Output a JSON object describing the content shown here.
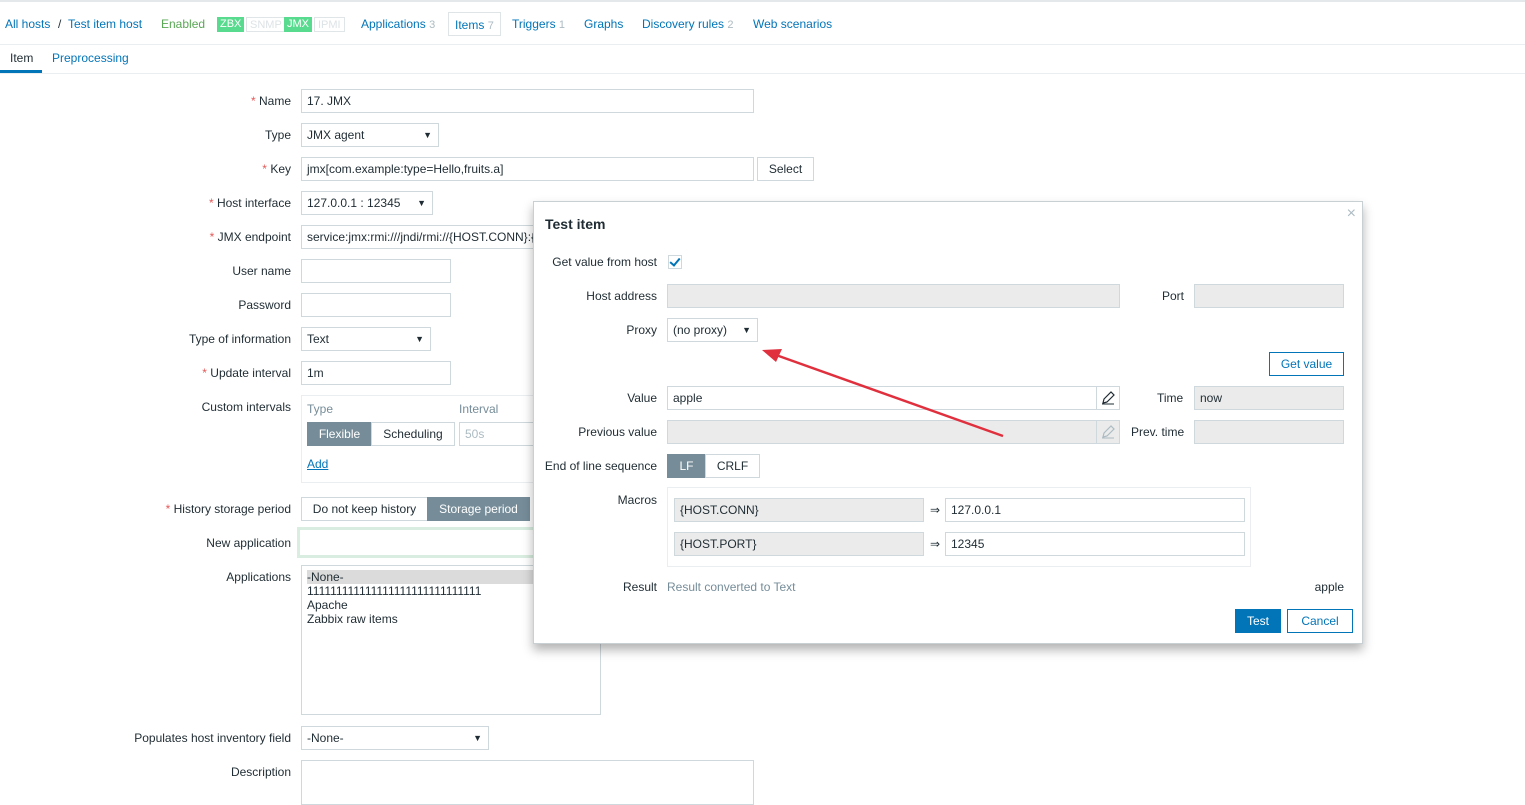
{
  "breadcrumbs": {
    "all_hosts": "All hosts",
    "sep": "/",
    "host": "Test item host",
    "status": "Enabled",
    "availability": [
      "ZBX",
      "SNMP",
      "JMX",
      "IPMI"
    ],
    "links": [
      {
        "label": "Applications",
        "count": "3"
      },
      {
        "label": "Items",
        "count": "7"
      },
      {
        "label": "Triggers",
        "count": "1"
      },
      {
        "label": "Graphs",
        "count": ""
      },
      {
        "label": "Discovery rules",
        "count": "2"
      },
      {
        "label": "Web scenarios",
        "count": ""
      }
    ]
  },
  "tabs": [
    "Item",
    "Preprocessing"
  ],
  "form": {
    "required_mark": "*",
    "name_label": "Name",
    "name_value": "17. JMX",
    "type_label": "Type",
    "type_value": "JMX agent",
    "key_label": "Key",
    "key_value": "jmx[com.example:type=Hello,fruits.a]",
    "key_select": "Select",
    "iface_label": "Host interface",
    "iface_value": "127.0.0.1 : 12345",
    "jmx_label": "JMX endpoint",
    "jmx_value": "service:jmx:rmi:///jndi/rmi://{HOST.CONN}:{HOST.PORT}/jmxrmi",
    "user_label": "User name",
    "user_value": "",
    "pass_label": "Password",
    "pass_value": "",
    "toi_label": "Type of information",
    "toi_value": "Text",
    "update_label": "Update interval",
    "update_value": "1m",
    "ci_label": "Custom intervals",
    "ci_type_header": "Type",
    "ci_interval_header": "Interval",
    "ci_flexible": "Flexible",
    "ci_scheduling": "Scheduling",
    "ci_interval_value": "50s",
    "ci_add": "Add",
    "history_label": "History storage period",
    "history_opt1": "Do not keep history",
    "history_opt2": "Storage period",
    "newapp_label": "New application",
    "newapp_value": "",
    "apps_label": "Applications",
    "apps": [
      "-None-",
      "111111111111111111111111111111",
      "Apache",
      "Zabbix raw items"
    ],
    "inventory_label": "Populates host inventory field",
    "inventory_value": "-None-",
    "desc_label": "Description"
  },
  "dialog": {
    "title": "Test item",
    "close": "×",
    "get_value_label": "Get value from host",
    "host_address_label": "Host address",
    "host_address_value": "",
    "port_label": "Port",
    "port_value": "",
    "proxy_label": "Proxy",
    "proxy_value": "(no proxy)",
    "get_value_button": "Get value",
    "value_label": "Value",
    "value_value": "apple",
    "time_label": "Time",
    "time_value": "now",
    "prev_value_label": "Previous value",
    "prev_value_value": "",
    "prev_time_label": "Prev. time",
    "prev_time_value": "",
    "eol_label": "End of line sequence",
    "eol_lf": "LF",
    "eol_crlf": "CRLF",
    "macros_label": "Macros",
    "macros": [
      {
        "name": "{HOST.CONN}",
        "arrow": "⇒",
        "value": "127.0.0.1"
      },
      {
        "name": "{HOST.PORT}",
        "arrow": "⇒",
        "value": "12345"
      }
    ],
    "result_label": "Result",
    "result_note": "Result converted to Text",
    "result_value": "apple",
    "test_button": "Test",
    "cancel_button": "Cancel"
  },
  "colors": {
    "link": "#0275b8",
    "enabled": "#59a854",
    "avail_on": "#59db8f",
    "annotation_arrow": "#e0303e"
  }
}
